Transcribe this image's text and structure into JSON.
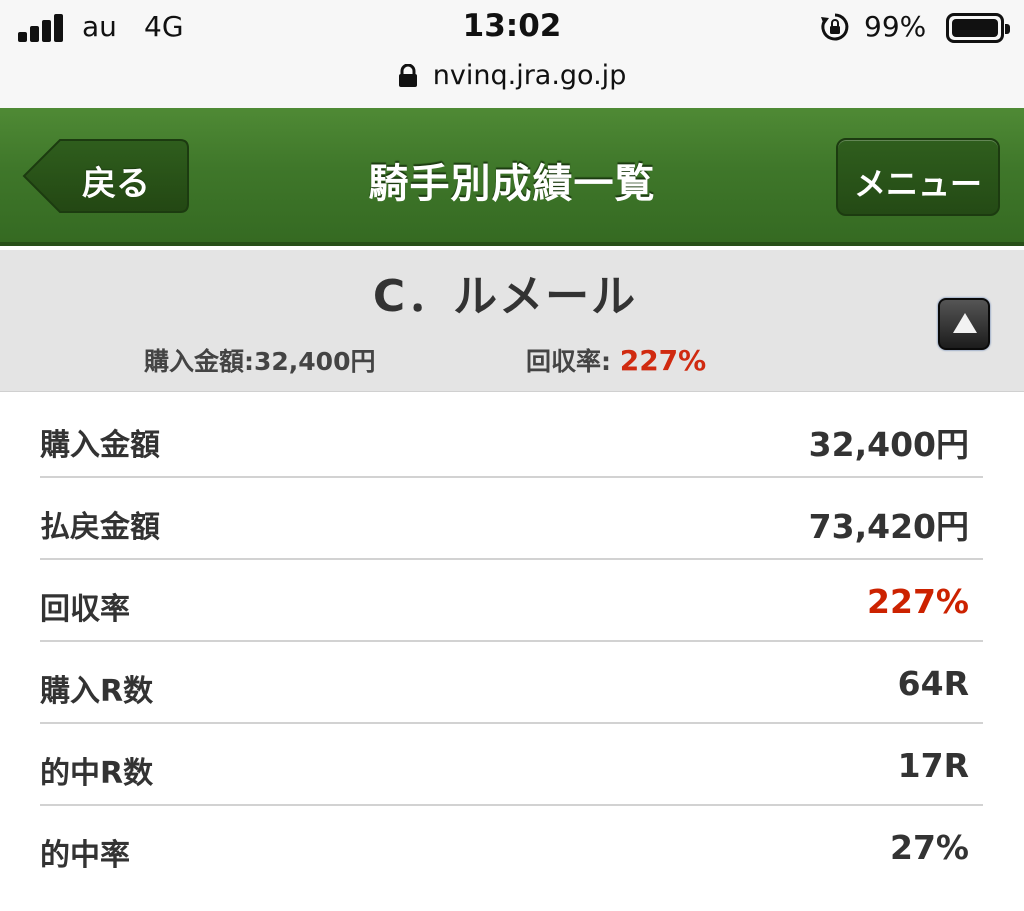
{
  "status_bar": {
    "carrier": "au",
    "network": "4G",
    "time": "13:02",
    "battery_percent": "99%",
    "icons": [
      "signal-icon",
      "rotation-lock-icon",
      "battery-icon"
    ]
  },
  "browser": {
    "url": "nvinq.jra.go.jp",
    "icons": [
      "padlock-icon"
    ]
  },
  "header": {
    "back_label": "戻る",
    "title": "騎手別成績一覧",
    "menu_label": "メニュー",
    "colors": {
      "bar": "#3f772a",
      "button": "#2a5519"
    }
  },
  "summary": {
    "jockey_name": "C．ルメール",
    "purchase_text": "購入金額:32,400円",
    "recovery_label": "回収率:",
    "recovery_value": "227%",
    "collapse_icon": "triangle-up-icon"
  },
  "stats": [
    {
      "label": "購入金額",
      "value": "32,400円",
      "highlight": false
    },
    {
      "label": "払戻金額",
      "value": "73,420円",
      "highlight": false
    },
    {
      "label": "回収率",
      "value": "227%",
      "highlight": true
    },
    {
      "label": "購入R数",
      "value": "64R",
      "highlight": false
    },
    {
      "label": "的中R数",
      "value": "17R",
      "highlight": false
    },
    {
      "label": "的中率",
      "value": "27%",
      "highlight": false
    }
  ],
  "colors": {
    "highlight": "#cc2200",
    "summary_band": "#e4e4e4"
  }
}
